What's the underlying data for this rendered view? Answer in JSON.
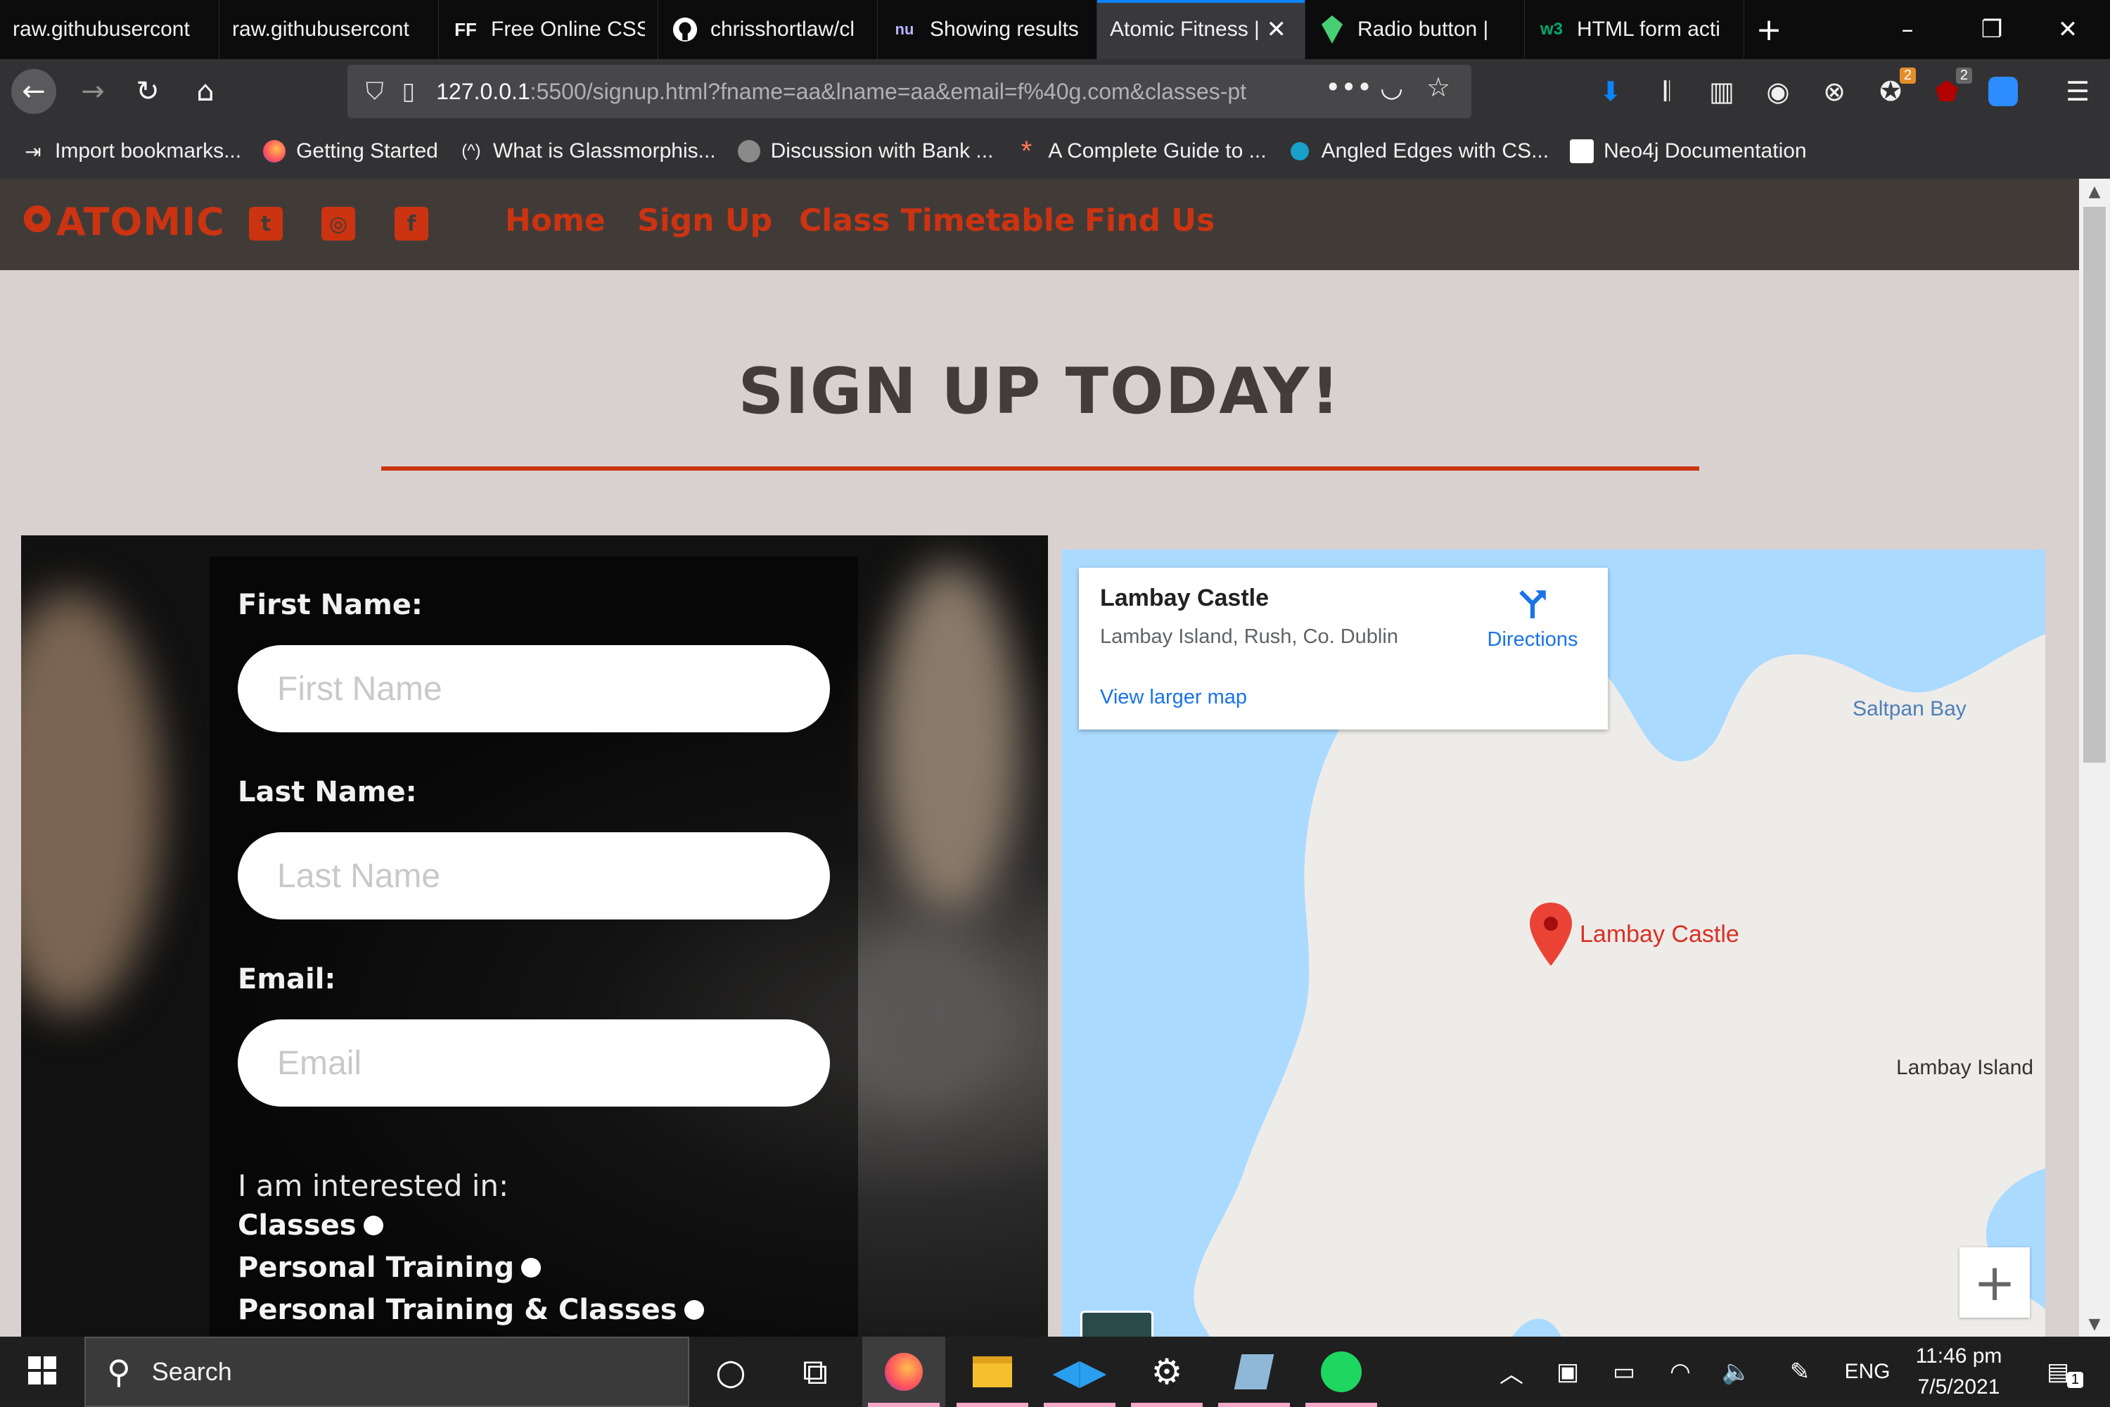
{
  "browser": {
    "tabs": [
      {
        "label": "raw.githubusercont",
        "icon": "",
        "active": false
      },
      {
        "label": "raw.githubusercont",
        "icon": "",
        "active": false
      },
      {
        "label": "Free Online CSS",
        "icon": "FF",
        "active": false
      },
      {
        "label": "chrisshortlaw/cl",
        "icon": "github-icon",
        "active": false
      },
      {
        "label": "Showing results",
        "icon": "nu",
        "active": false
      },
      {
        "label": "Atomic Fitness |",
        "icon": "",
        "active": true
      },
      {
        "label": "Radio button | ",
        "icon": "codepen-icon",
        "active": false
      },
      {
        "label": "HTML form acti",
        "icon": "w3",
        "active": false
      }
    ],
    "url_host": "127.0.0.1",
    "url_path": ":5500/signup.html?fname=aa&lname=aa&email=f%40g.com&classes-pt",
    "badges": {
      "extension_a": "2",
      "ublock": "2"
    },
    "bookmarks": [
      {
        "label": "Import bookmarks...",
        "icon": "import-icon"
      },
      {
        "label": "Getting Started",
        "icon": "firefox-icon"
      },
      {
        "label": "What is Glassmorphis...",
        "icon": "(^)"
      },
      {
        "label": "Discussion with Bank ...",
        "icon": "discussion-icon"
      },
      {
        "label": "A Complete Guide to ...",
        "icon": "*"
      },
      {
        "label": "Angled Edges with CS...",
        "icon": "dot-icon"
      },
      {
        "label": "Neo4j Documentation",
        "icon": "neo4j-icon"
      }
    ]
  },
  "site": {
    "logo": "ATOMIC",
    "social_icons": [
      "twitter-icon",
      "instagram-icon",
      "facebook-icon"
    ],
    "nav": [
      "Home",
      "Sign Up",
      "Class Timetable",
      "Find Us"
    ],
    "heading": "SIGN UP TODAY!",
    "accent_color": "#cc3311",
    "form": {
      "first_name_label": "First Name:",
      "first_name_placeholder": "First Name",
      "last_name_label": "Last Name:",
      "last_name_placeholder": "Last Name",
      "email_label": "Email:",
      "email_placeholder": "Email",
      "interest_label": "I am interested in:",
      "options": [
        "Classes",
        "Personal Training",
        "Personal Training & Classes"
      ]
    },
    "map": {
      "place_name": "Lambay Castle",
      "address": "Lambay Island, Rush, Co. Dublin",
      "directions": "Directions",
      "larger_map": "View larger map",
      "labels": {
        "bay": "Saltpan Bay",
        "marker": "Lambay Castle",
        "island": "Lambay Island"
      },
      "zoom_in": "+"
    }
  },
  "taskbar": {
    "search_text": "Search",
    "tray_language": "ENG",
    "time": "11:46 pm",
    "date": "7/5/2021",
    "notifications": "1"
  }
}
